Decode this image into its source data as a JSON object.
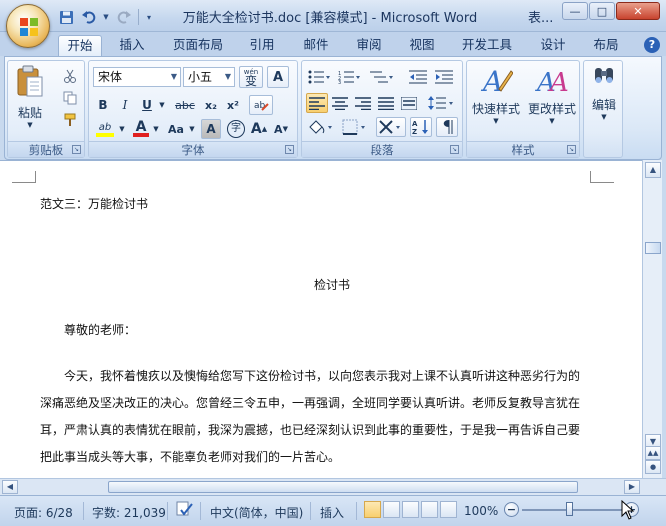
{
  "window": {
    "title": "万能大全检讨书.doc [兼容模式] - Microsoft Word",
    "other_window_title": "表...",
    "buttons": {
      "minimize": "—",
      "maximize": "□",
      "close": "✕"
    }
  },
  "qat": {
    "save": "save-icon",
    "undo": "undo-icon",
    "redo": "redo-icon"
  },
  "tabs": [
    {
      "label": "开始",
      "active": true
    },
    {
      "label": "插入"
    },
    {
      "label": "页面布局"
    },
    {
      "label": "引用"
    },
    {
      "label": "邮件"
    },
    {
      "label": "审阅"
    },
    {
      "label": "视图"
    },
    {
      "label": "开发工具"
    },
    {
      "label": "设计"
    },
    {
      "label": "布局"
    }
  ],
  "help_label": "?",
  "ribbon": {
    "clipboard": {
      "label": "剪贴板",
      "paste": "粘贴"
    },
    "font": {
      "label": "字体",
      "font_name": "宋体",
      "font_size": "小五",
      "wen": "wén",
      "wen_char": "变",
      "a_box": "A",
      "bold": "B",
      "italic": "I",
      "underline": "U",
      "strike": "abc",
      "sub": "x₂",
      "sup": "x²",
      "aa": "Aa",
      "char_shade": "A",
      "enclose": "字",
      "grow": "A",
      "shrink": "A",
      "highlight": "ab",
      "font_color": "A"
    },
    "paragraph": {
      "label": "段落"
    },
    "styles": {
      "label": "样式",
      "quick_styles": "快速样式",
      "change_styles": "更改样式"
    },
    "editing": {
      "label": "编辑"
    }
  },
  "document": {
    "heading_line": "范文三：万能检讨书",
    "title": "检讨书",
    "salutation": "尊敬的老师：",
    "body_lines": [
      "今天，我怀着愧疚以及懊悔给您写下这份检讨书，以向您表示我对上课不认真听讲这种恶劣行为的",
      "深痛恶绝及坚决改正的决心。您曾经三令五申，一再强调，全班同学要认真听讲。老师反复教导言犹在",
      "耳，严肃认真的表情犹在眼前，我深为震撼，也已经深刻认识到此事的重要性，于是我一再告诉自己要",
      "把此事当成头等大事，不能辜负老师对我们的一片苦心。"
    ]
  },
  "status": {
    "page": "页面: 6/28",
    "words": "字数: 21,039",
    "language": "中文(简体，中国)",
    "mode": "插入",
    "zoom": "100%",
    "zoom_percent": 100
  },
  "colors": {
    "accent_blue": "#2b61b6",
    "active_orange": "#f8cf6f",
    "font_color_red": "#e02020",
    "highlight_yellow": "#ffff00"
  }
}
